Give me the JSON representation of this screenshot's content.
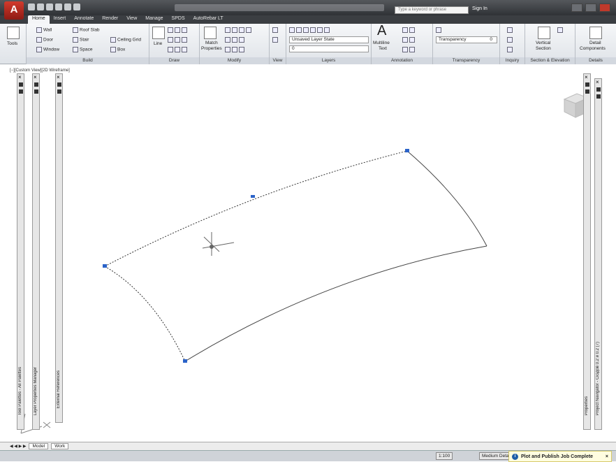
{
  "app": {
    "logo": "A",
    "search_placeholder": "Type a keyword or phrase",
    "signin": "Sign In"
  },
  "tabs": [
    "Home",
    "Insert",
    "Annotate",
    "Render",
    "View",
    "Manage",
    "SPDS",
    "AutoRebar LT"
  ],
  "ribbon": {
    "tools": "Tools",
    "build": {
      "title": "Build",
      "wall": "Wall",
      "door": "Door",
      "window": "Window",
      "roof_slab": "Roof Slab",
      "stair": "Stair",
      "space": "Space",
      "ceiling_grid": "Ceiling Grid",
      "box": "Box"
    },
    "draw": {
      "title": "Draw",
      "line": "Line"
    },
    "modify": {
      "title": "Modify",
      "match": "Match",
      "properties": "Properties"
    },
    "view": {
      "title": "View"
    },
    "layers": {
      "title": "Layers",
      "state": "Unsaved Layer State",
      "layer": "0"
    },
    "annotation": {
      "title": "Annotation",
      "text": "Multiline",
      "text2": "Text"
    },
    "transparency": {
      "title": "Transparency",
      "label": "Transparency",
      "value": "0"
    },
    "inquiry": {
      "title": "Inquiry"
    },
    "section": {
      "title": "Section & Elevation",
      "vertical": "Vertical",
      "section": "Section"
    },
    "details": {
      "title": "Details",
      "detail": "Detail",
      "components": "Components"
    }
  },
  "viewport": {
    "label": "[−][Custom View][2D Wireframe]"
  },
  "palettes": {
    "tool": "Tool Palettes - All Palettes",
    "layer": "Layer Properties Manager",
    "xref": "External References",
    "properties": "Properties",
    "project": "Project Navigator - Скэдов 0.2 и 0.2 (7)"
  },
  "layout_tabs": [
    "Model",
    "Work"
  ],
  "status": {
    "scale": "1:100",
    "detail": "Medium Detail",
    "notification": "Plot and Publish Job Complete"
  }
}
